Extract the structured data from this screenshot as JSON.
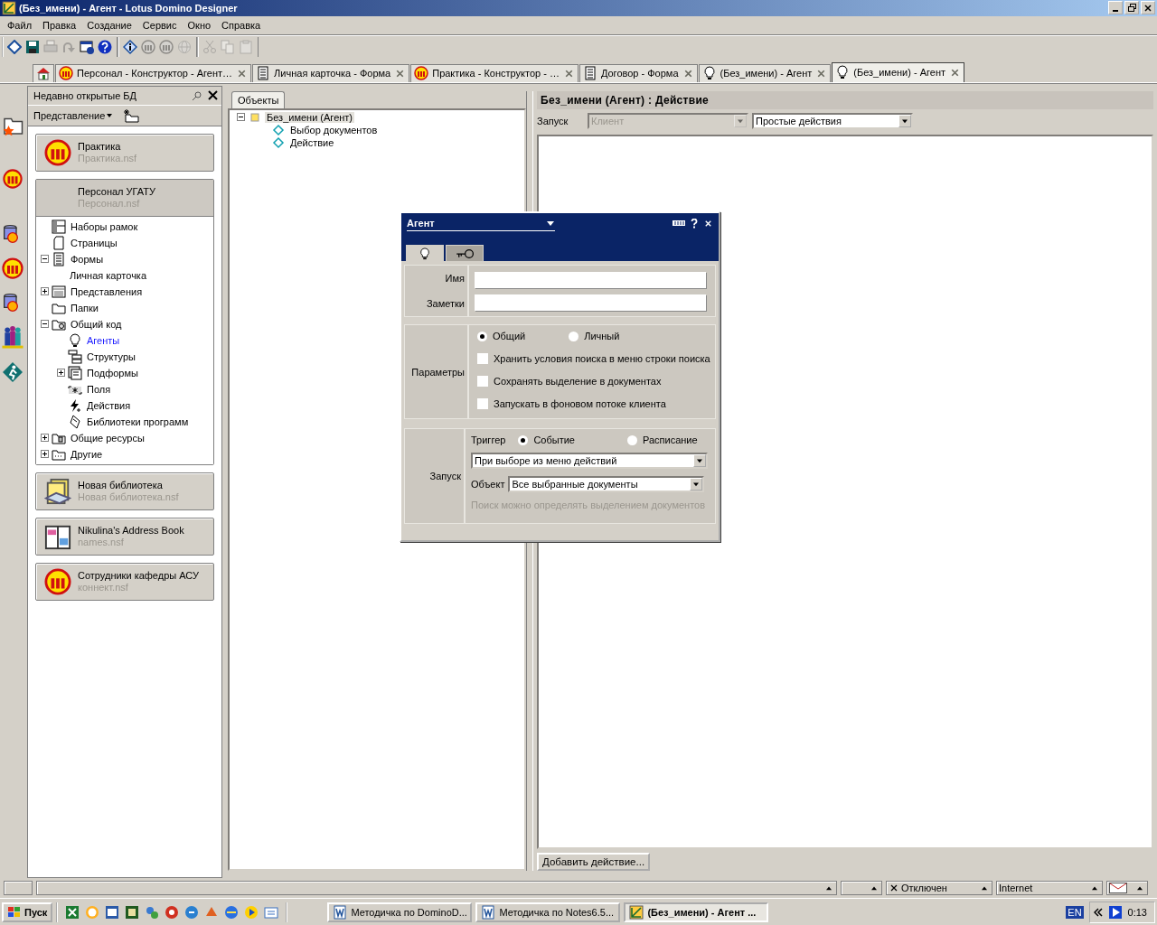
{
  "window": {
    "title": "(Без_имени) - Агент - Lotus Domino Designer"
  },
  "menu": [
    "Файл",
    "Правка",
    "Создание",
    "Сервис",
    "Окно",
    "Справка"
  ],
  "toolbar": [
    [
      {
        "disabled": false
      },
      {
        "disabled": false
      },
      {
        "disabled": true
      },
      {
        "disabled": true
      },
      {
        "disabled": false
      },
      {
        "disabled": false
      }
    ],
    [
      {
        "disabled": false
      },
      {
        "disabled": true
      },
      {
        "disabled": true
      },
      {
        "disabled": true
      }
    ],
    [
      {
        "disabled": true
      },
      {
        "disabled": true
      },
      {
        "disabled": true
      }
    ]
  ],
  "tabs": [
    {
      "kind": "home",
      "selected": false
    },
    {
      "kind": "database",
      "label": "Персонал - Конструктор - Агент…",
      "selected": false
    },
    {
      "kind": "form",
      "label": "Личная карточка - Форма",
      "selected": false
    },
    {
      "kind": "database",
      "label": "Практика - Конструктор - …",
      "selected": false
    },
    {
      "kind": "form",
      "label": "Договор - Форма",
      "selected": false
    },
    {
      "kind": "agent",
      "label": "(Без_имени) - Агент",
      "selected": false
    },
    {
      "kind": "agent",
      "label": "(Без_имени) - Агент",
      "selected": true
    }
  ],
  "sidebar": {
    "title": "Недавно открытые БД",
    "view_menu": "Представление",
    "databases": [
      {
        "kind": "database",
        "name": "Практика",
        "file": "Практика.nsf",
        "selected": false
      },
      {
        "kind": "project",
        "name": "Персонал УГАТУ",
        "file": "Персонал.nsf",
        "selected": true,
        "tree": [
          {
            "kind": "frameset",
            "label": "Наборы рамок",
            "selected": false
          },
          {
            "kind": "page",
            "label": "Страницы",
            "selected": false
          },
          {
            "kind": "form",
            "label": "Формы",
            "selected": false,
            "expanded": true,
            "children": [
              {
                "kind": "plain",
                "label": "Личная карточка",
                "selected": false
              }
            ]
          },
          {
            "kind": "view",
            "label": "Представления",
            "selected": false,
            "expanded": false
          },
          {
            "kind": "folder",
            "label": "Папки",
            "selected": false
          },
          {
            "kind": "shared-code",
            "label": "Общий код",
            "selected": false,
            "expanded": true,
            "children": [
              {
                "kind": "agent",
                "label": "Агенты",
                "selected": true
              },
              {
                "kind": "outline",
                "label": "Структуры",
                "selected": false
              },
              {
                "kind": "subform",
                "label": "Подформы",
                "selected": false,
                "expanded": false
              },
              {
                "kind": "field",
                "label": "Поля",
                "selected": false
              },
              {
                "kind": "action",
                "label": "Действия",
                "selected": false
              },
              {
                "kind": "library",
                "label": "Библиотеки программ",
                "selected": false
              }
            ]
          },
          {
            "kind": "resources",
            "label": "Общие ресурсы",
            "selected": false,
            "expanded": false
          },
          {
            "kind": "other",
            "label": "Другие",
            "selected": false,
            "expanded": false
          }
        ]
      },
      {
        "kind": "library-db",
        "name": "Новая библиотека",
        "file": "Новая библиотека.nsf",
        "selected": false
      },
      {
        "kind": "address-book",
        "name": "Nikulina's Address Book",
        "file": "names.nsf",
        "selected": false
      },
      {
        "kind": "database",
        "name": "Сотрудники кафедры АСУ",
        "file": "коннект.nsf",
        "selected": false
      }
    ]
  },
  "objects": {
    "tab": "Объекты",
    "tree": [
      {
        "kind": "agent-root",
        "label": "Без_имени (Агент)",
        "selected": true,
        "expanded": true,
        "children": [
          {
            "kind": "event",
            "label": "Выбор документов",
            "selected": false
          },
          {
            "kind": "event",
            "label": "Действие",
            "selected": false
          }
        ]
      }
    ]
  },
  "editor": {
    "title": "Без_имени (Агент) : Действие",
    "run_label": "Запуск",
    "target": {
      "value": "Клиент",
      "disabled": true
    },
    "language": {
      "value": "Простые действия",
      "disabled": false
    },
    "add_button": "Добавить действие..."
  },
  "dialog": {
    "title": "Агент",
    "tabs": [
      {
        "selected": true
      },
      {
        "selected": false
      }
    ],
    "fields": [
      {
        "label": "Имя"
      },
      {
        "label": "Заметки"
      }
    ],
    "options": {
      "label": "Параметры",
      "scope": [
        {
          "label": "Общий",
          "selected": true
        },
        {
          "label": "Личный",
          "selected": false
        }
      ],
      "checkboxes": [
        {
          "label": "Хранить условия поиска в меню строки поиска",
          "checked": false
        },
        {
          "label": "Сохранять выделение в документах",
          "checked": false
        },
        {
          "label": "Запускать в фоновом потоке клиента",
          "checked": false
        }
      ]
    },
    "launch": {
      "label": "Запуск",
      "trigger_label": "Триггер",
      "trigger": [
        {
          "label": "Событие",
          "selected": true
        },
        {
          "label": "Расписание",
          "selected": false
        }
      ],
      "event": "При выборе из меню действий",
      "target_label": "Объект",
      "target": "Все выбранные документы",
      "hint": "Поиск можно определять выделением документов"
    }
  },
  "status_bar": {
    "segments": [
      {
        "kind": "offline",
        "text": "Отключен"
      },
      {
        "kind": "network",
        "text": "Internet"
      }
    ]
  },
  "taskbar": {
    "start": "Пуск",
    "tasks": [
      {
        "kind": "document",
        "label": "Методичка по DominoD...",
        "selected": false
      },
      {
        "kind": "document",
        "label": "Методичка по Notes6.5...",
        "selected": false
      },
      {
        "kind": "designer",
        "label": "(Без_имени) - Агент ...",
        "selected": true
      }
    ],
    "language": "EN",
    "clock": "0:13"
  }
}
